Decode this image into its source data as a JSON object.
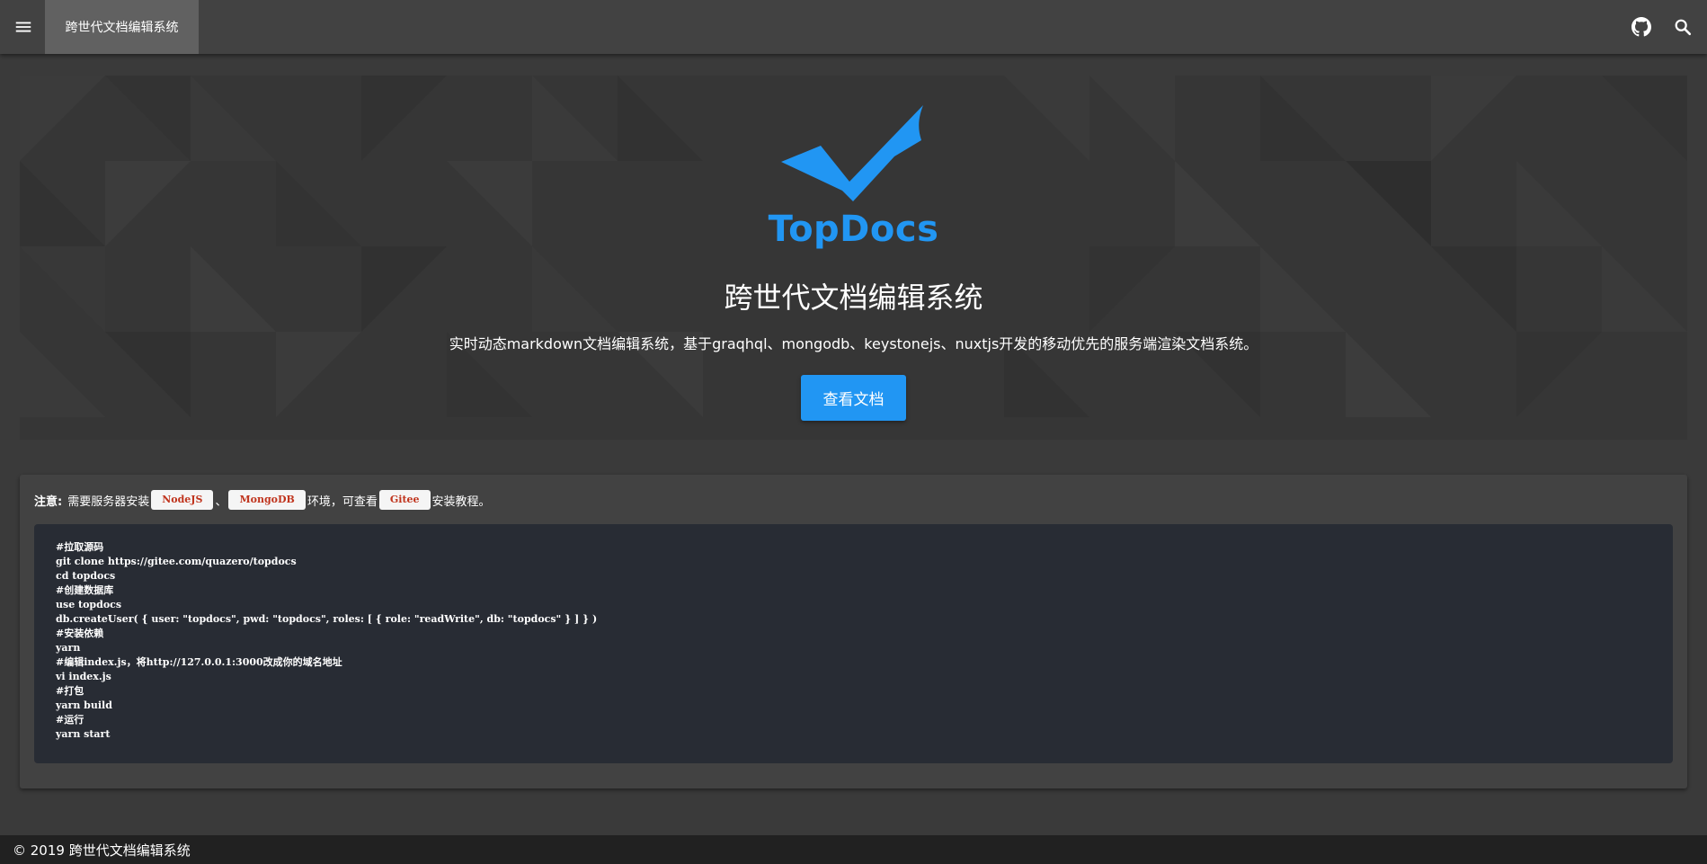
{
  "header": {
    "title": "跨世代文档编辑系统",
    "menu_icon": "menu-icon",
    "github_icon": "github-icon",
    "search_icon": "search-icon"
  },
  "hero": {
    "logo_text": "TopDocs",
    "title": "跨世代文档编辑系统",
    "subtitle": "实时动态markdown文档编辑系统，基于graqhql、mongodb、keystonejs、nuxtjs开发的移动优先的服务端渲染文档系统。",
    "button_label": "查看文档",
    "logo_icon": "checkmark-logo-icon"
  },
  "install": {
    "note_label": "注意:",
    "note_part1": "需要服务器安装",
    "chip_nodejs": "NodeJS",
    "separator": "、",
    "chip_mongodb": "MongoDB",
    "note_part2": "环境，可查看",
    "chip_gitee": "Gitee",
    "note_part3": "安装教程。",
    "code_lines": [
      "#拉取源码",
      "git clone https://gitee.com/quazero/topdocs",
      "cd topdocs",
      "#创建数据库",
      "use topdocs",
      "db.createUser( { user: \"topdocs\", pwd: \"topdocs\", roles: [ { role: \"readWrite\", db: \"topdocs\" } ] } )",
      "#安装依赖",
      "yarn",
      "#编辑index.js，将http://127.0.0.1:3000改成你的域名地址",
      "vi index.js",
      "#打包",
      "yarn build",
      "#运行",
      "yarn start"
    ]
  },
  "footer": {
    "copyright": "© 2019 跨世代文档编辑系统"
  },
  "colors": {
    "accent": "#2196f3",
    "topbar": "#424242",
    "code_bg": "#282c34",
    "chip_text": "#c0341d"
  }
}
